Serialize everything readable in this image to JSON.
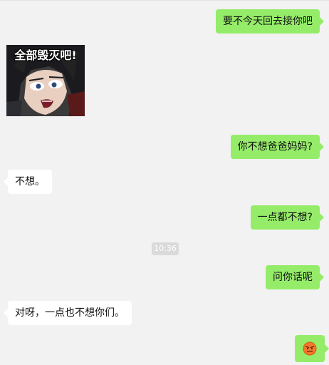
{
  "messages": [
    {
      "id": "m1",
      "side": "out",
      "text": "要不今天回去接你吧"
    },
    {
      "id": "m2",
      "side": "in",
      "type": "sticker",
      "caption": "全部毁灭吧!"
    },
    {
      "id": "m3",
      "side": "out",
      "text": "你不想爸爸妈妈?"
    },
    {
      "id": "m4",
      "side": "in",
      "text": "不想。"
    },
    {
      "id": "m5",
      "side": "out",
      "text": "一点都不想?"
    },
    {
      "id": "m6",
      "side": "out",
      "text": "问你话呢"
    },
    {
      "id": "m7",
      "side": "in",
      "text": "对呀，一点也不想你们。"
    },
    {
      "id": "m8",
      "side": "out",
      "type": "emoji",
      "icon": "angry-face-icon"
    }
  ],
  "timestamp": "10:36",
  "colors": {
    "outgoing_bubble": "#95ec69",
    "incoming_bubble": "#ffffff",
    "background": "#f2f2f2",
    "timestamp_bg": "#dadada"
  }
}
